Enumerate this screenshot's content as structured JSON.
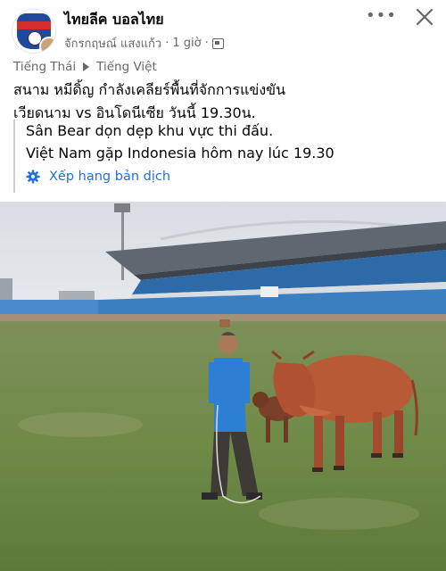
{
  "post": {
    "page_name": "ไทยลีค บอลไทย",
    "author": "จักรกฤษณ์ แสงแก้ว",
    "time": "1 giờ",
    "separator": "·",
    "more_label": "•••"
  },
  "translation_bar": {
    "source_lang": "Tiếng Thái",
    "target_lang": "Tiếng Việt"
  },
  "original_text": {
    "line1": "สนาม หมีดิ้ญ กำลังเคลียร์พื้นที่จักการแข่งขัน",
    "line2": "เวียดนาม vs อินโดนีเซีย วันนี้ 19.30น."
  },
  "translated_text": {
    "line1": "Sân Bear dọn dẹp khu vực thi đấu.",
    "line2": "Việt Nam gặp Indonesia hôm nay lúc 19.30"
  },
  "rate_translation": {
    "label": "Xếp hạng bản dịch"
  },
  "icons": {
    "more": "more-icon",
    "close": "close-icon",
    "audience": "audience-icon",
    "gear": "gear-icon"
  },
  "colors": {
    "link_blue": "#216fdb",
    "meta_gray": "#65676b"
  }
}
